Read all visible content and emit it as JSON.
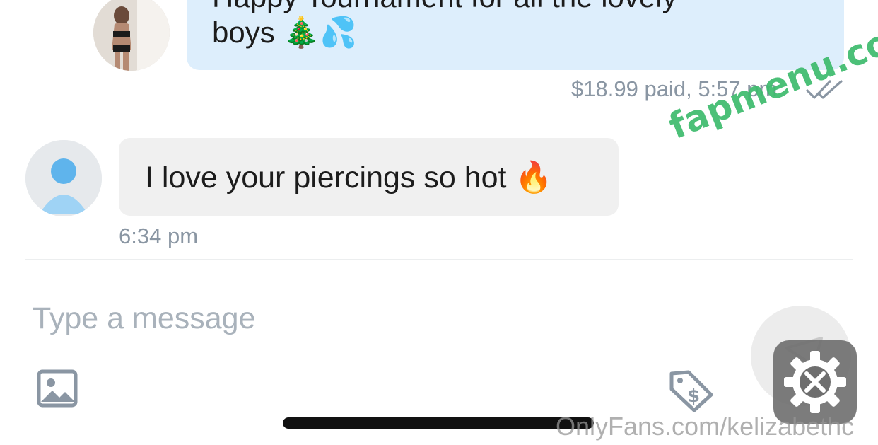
{
  "thread": {
    "outgoing": {
      "text_partial": "Happy Tournament for all the lovely",
      "text": "boys 🎄💦",
      "price": "$18.99",
      "paid_label": "paid,",
      "time": "5:57 pm",
      "status_icon": "double-check-icon"
    },
    "incoming": {
      "text": "I love your piercings so hot 🔥",
      "time": "6:34 pm",
      "avatar_icon": "default-user-icon"
    }
  },
  "composer": {
    "placeholder": "Type a message",
    "media_icon": "image-icon",
    "price_icon": "price-tag-icon",
    "send_icon": "send-icon",
    "settings_icon": "settings-gear-icon"
  },
  "watermarks": {
    "site": "fapmenu.com",
    "source": "OnlyFans.com/kelizabethc"
  },
  "colors": {
    "outgoing_bubble": "#ddeefc",
    "incoming_bubble": "#f0f0f0",
    "meta_text": "#8a96a3",
    "accent_blue": "#5fb4ec",
    "watermark_green": "#3dbb6d"
  }
}
